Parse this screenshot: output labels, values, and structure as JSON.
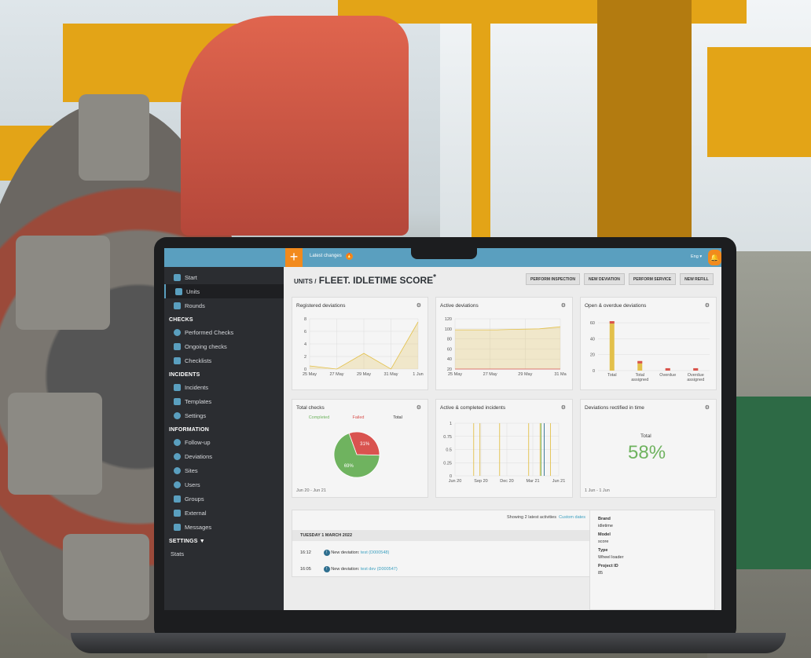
{
  "topbar": {
    "latest_label": "Latest changes",
    "latest_badge": "🔥",
    "lang": "Eng ▾"
  },
  "sidebar": {
    "items": [
      {
        "label": "Start"
      },
      {
        "label": "Units"
      },
      {
        "label": "Rounds"
      }
    ],
    "checks_head": "CHECKS",
    "checks": [
      {
        "label": "Performed Checks"
      },
      {
        "label": "Ongoing checks"
      },
      {
        "label": "Checklists"
      }
    ],
    "incidents_head": "INCIDENTS",
    "incidents": [
      {
        "label": "Incidents"
      },
      {
        "label": "Templates"
      },
      {
        "label": "Settings"
      }
    ],
    "information_head": "INFORMATION",
    "information": [
      {
        "label": "Follow-up"
      },
      {
        "label": "Deviations"
      },
      {
        "label": "Sites"
      },
      {
        "label": "Users"
      },
      {
        "label": "Groups"
      },
      {
        "label": "External"
      },
      {
        "label": "Messages"
      }
    ],
    "settings_head": "SETTINGS ▼",
    "stats": "Stats"
  },
  "page": {
    "title_prefix": "UNITS /",
    "title": "FLEET. IDLETIME SCORE",
    "star": "*",
    "buttons": [
      "PERFORM INSPECTION",
      "NEW DEVIATION",
      "PERFORM SERVICE",
      "NEW REFILL"
    ]
  },
  "cards": {
    "registered": {
      "title": "Registered deviations"
    },
    "active": {
      "title": "Active deviations"
    },
    "open": {
      "title": "Open & overdue deviations"
    },
    "total_checks": {
      "title": "Total checks",
      "footer": "Jun 20 - Jun 21"
    },
    "active_completed": {
      "title": "Active & completed incidents"
    },
    "rectified": {
      "title": "Deviations rectified in time",
      "total_label": "Total",
      "value": "58%",
      "footer": "1 Jun - 1 Jun"
    }
  },
  "chart_data": [
    {
      "type": "area",
      "title": "Registered deviations",
      "x": [
        "25 May",
        "27 May",
        "29 May",
        "31 May",
        "1 Jun"
      ],
      "yticks": [
        0,
        2,
        4,
        6,
        8
      ],
      "ylim": [
        0,
        8
      ],
      "series": [
        {
          "values": [
            0.5,
            0,
            2.5,
            0,
            7.5
          ]
        }
      ]
    },
    {
      "type": "area",
      "title": "Active deviations",
      "x": [
        "25 May",
        "27 May",
        "29 May",
        "31 Ma"
      ],
      "yticks": [
        20,
        40,
        60,
        80,
        100,
        120
      ],
      "ylim": [
        20,
        120
      ],
      "series": [
        {
          "values": [
            98,
            98,
            98,
            99,
            100,
            104
          ]
        },
        {
          "values": [
            20,
            20,
            20,
            20,
            20,
            20
          ]
        }
      ]
    },
    {
      "type": "bar",
      "title": "Open & overdue deviations",
      "categories": [
        "Total",
        "Total assigned",
        "Overdue",
        "Overdue assigned"
      ],
      "yticks": [
        0,
        20,
        40,
        60
      ],
      "ylim": [
        0,
        65
      ],
      "values": [
        62,
        12,
        3,
        3
      ]
    },
    {
      "type": "pie",
      "title": "Total checks",
      "legend": [
        "Completed",
        "Failed",
        "Total"
      ],
      "slices": [
        {
          "label": "Failed",
          "value": 31
        },
        {
          "label": "Completed",
          "value": 69
        }
      ]
    },
    {
      "type": "line",
      "title": "Active & completed incidents",
      "x": [
        "Jun 20",
        "Sep 20",
        "Dec 20",
        "Mar 21",
        "Jun 21"
      ],
      "yticks": [
        0,
        0.25,
        0.5,
        0.75,
        1
      ],
      "ylim": [
        0,
        1
      ]
    }
  ],
  "activity": {
    "showing": "Showing 2 latest activities",
    "custom": "Custom dates",
    "date": "TUESDAY 1 MARCH 2022",
    "rows": [
      {
        "time": "16:12",
        "text": "New deviation:",
        "link": "test (D000548)"
      },
      {
        "time": "16:05",
        "text": "New deviation:",
        "link": "test dev (D000547)"
      }
    ]
  },
  "info": [
    {
      "key": "Brand",
      "value": "idletime"
    },
    {
      "key": "Model",
      "value": "score"
    },
    {
      "key": "Type",
      "value": "Wheel loader"
    },
    {
      "key": "Project ID",
      "value": "85"
    }
  ],
  "colors": {
    "accent": "#5a9fbf",
    "orange": "#f28a1d",
    "green": "#6fb35f",
    "red": "#d9534f",
    "yellow": "#e3c04a"
  }
}
